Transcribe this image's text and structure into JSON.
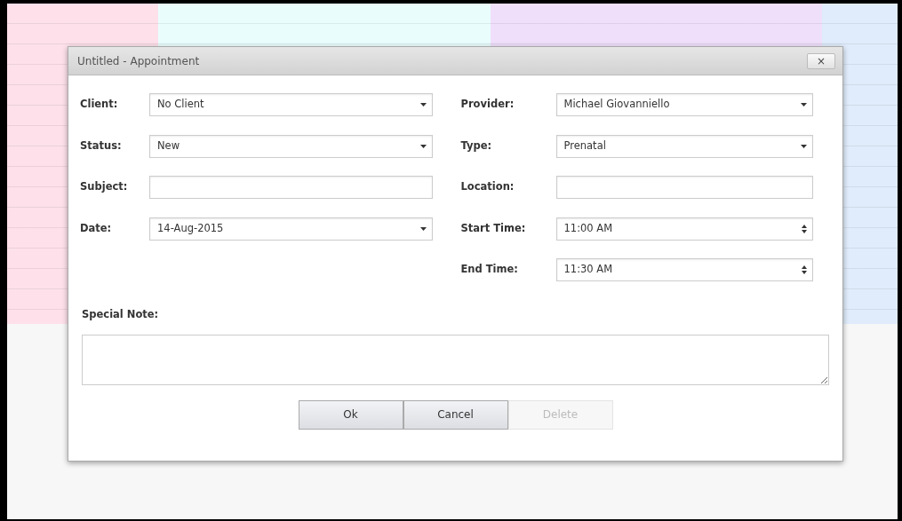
{
  "calendar_columns": [
    {
      "color": "#fde0ea"
    },
    {
      "color": "#eafdfd"
    },
    {
      "color": "#efdffb"
    },
    {
      "color": "#e0ecfb"
    }
  ],
  "dialog": {
    "title": "Untitled - Appointment",
    "close": "×",
    "left_fields": [
      {
        "label": "Client:",
        "kind": "select",
        "value": "No Client"
      },
      {
        "label": "Status:",
        "kind": "select",
        "value": "New"
      },
      {
        "label": "Subject:",
        "kind": "text"
      },
      {
        "label": "Date:",
        "kind": "select",
        "value": "14-Aug-2015"
      }
    ],
    "right_fields": [
      {
        "label": "Provider:",
        "kind": "select",
        "value": "Michael Giovanniello"
      },
      {
        "label": "Type:",
        "kind": "select",
        "value": "Prenatal"
      },
      {
        "label": "Location:",
        "kind": "text"
      },
      {
        "label": "Start Time:",
        "kind": "spinner",
        "value": "11:00 AM"
      },
      {
        "label": "End Time:",
        "kind": "spinner",
        "value": "11:30 AM"
      }
    ],
    "note_label": "Special Note:",
    "buttons": [
      {
        "label": "Ok",
        "disabled": false
      },
      {
        "label": "Cancel",
        "disabled": false
      },
      {
        "label": "Delete",
        "disabled": true
      }
    ]
  }
}
